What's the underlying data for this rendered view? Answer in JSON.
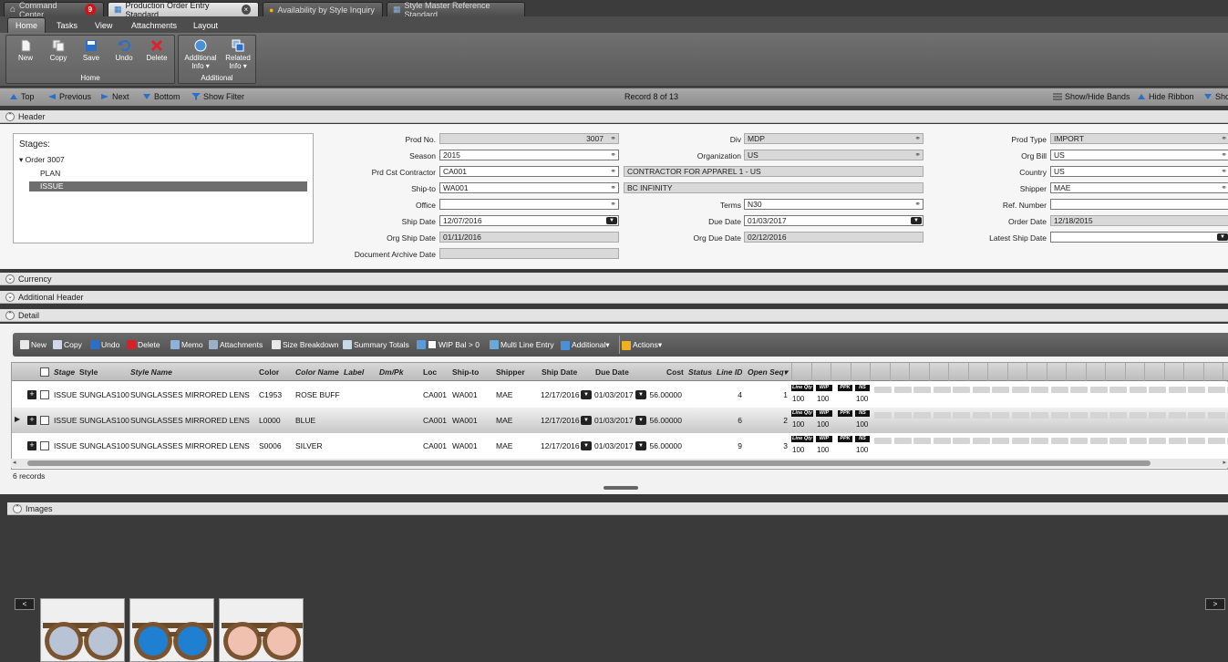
{
  "doc_tabs": [
    {
      "label": "Command Center",
      "badge": "9",
      "icon": "home-icon"
    },
    {
      "label": "Production Order Entry Standard",
      "close": "×",
      "icon": "form-icon",
      "active": true
    },
    {
      "label": "Availability by Style Inquiry",
      "icon": "info-icon"
    },
    {
      "label": "Style Master Reference Standard",
      "icon": "form-icon"
    }
  ],
  "menu": [
    "Home",
    "Tasks",
    "View",
    "Attachments",
    "Layout"
  ],
  "ribbon": {
    "group_home": {
      "label": "Home",
      "buttons": [
        "New",
        "Copy",
        "Save",
        "Undo",
        "Delete"
      ]
    },
    "group_additional": {
      "label": "Additional",
      "buttons": [
        {
          "line1": "Additional",
          "line2": "Info ▾"
        },
        {
          "line1": "Related",
          "line2": "Info ▾"
        }
      ]
    }
  },
  "navbar": {
    "top": "Top",
    "previous": "Previous",
    "next": "Next",
    "bottom": "Bottom",
    "show_filter": "Show Filter",
    "record": "Record 8 of 13",
    "show_hide_bands": "Show/Hide Bands",
    "hide_ribbon": "Hide Ribbon",
    "show": "Sho"
  },
  "sections": {
    "header": "Header",
    "currency": "Currency",
    "additional_header": "Additional Header",
    "detail": "Detail",
    "images": "Images"
  },
  "stages": {
    "title": "Stages:",
    "root": "Order 3007",
    "items": [
      "PLAN",
      "ISSUE"
    ]
  },
  "header_fields": {
    "col1": [
      {
        "label": "Prod No.",
        "value": "3007",
        "ro": true,
        "align": "right",
        "lookup": true
      },
      {
        "label": "Season",
        "value": "2015",
        "lookup": true
      },
      {
        "label": "Prd Cst Contractor",
        "value": "CA001",
        "lookup": true,
        "desc": "CONTRACTOR FOR APPAREL 1 - US"
      },
      {
        "label": "Ship-to",
        "value": "WA001",
        "lookup": true,
        "desc": "BC INFINITY"
      },
      {
        "label": "Office",
        "value": "",
        "lookup": true
      },
      {
        "label": "Ship Date",
        "value": "12/07/2016",
        "dropdown": true
      },
      {
        "label": "Org Ship Date",
        "value": "01/11/2016",
        "ro": true
      },
      {
        "label": "Document Archive Date",
        "value": "",
        "ro": true
      }
    ],
    "col2": [
      {
        "label": "Div",
        "value": "MDP",
        "ro": true,
        "lookup": true
      },
      {
        "label": "Organization",
        "value": "US",
        "ro": true,
        "lookup": true
      },
      {
        "label": "",
        "value": ""
      },
      {
        "label": "",
        "value": ""
      },
      {
        "label": "Terms",
        "value": "N30",
        "lookup": true
      },
      {
        "label": "Due Date",
        "value": "01/03/2017",
        "dropdown": true
      },
      {
        "label": "Org Due Date",
        "value": "02/12/2016",
        "ro": true
      }
    ],
    "col3": [
      {
        "label": "Prod Type",
        "value": "IMPORT",
        "ro": true,
        "lookup": true
      },
      {
        "label": "Org Bill",
        "value": "US",
        "lookup": true
      },
      {
        "label": "Country",
        "value": "US",
        "lookup": true
      },
      {
        "label": "Shipper",
        "value": "MAE",
        "lookup": true
      },
      {
        "label": "Ref. Number",
        "value": ""
      },
      {
        "label": "Order Date",
        "value": "12/18/2015",
        "ro": true
      },
      {
        "label": "Latest Ship Date",
        "value": "",
        "dropdown": true
      }
    ]
  },
  "detail_toolbar": [
    {
      "label": "New",
      "color": "#e8e8e8"
    },
    {
      "label": "Copy",
      "color": "#cfd8e8"
    },
    {
      "label": "Undo",
      "color": "#2a6fc9"
    },
    {
      "label": "Delete",
      "color": "#d8202a"
    },
    {
      "label": "Memo",
      "color": "#8fb0d8"
    },
    {
      "label": "Attachments",
      "color": "#9ab0c8"
    },
    {
      "label": "Size Breakdown",
      "color": "#e8e8e8"
    },
    {
      "label": "Summary Totals",
      "color": "#c8d8e8"
    },
    {
      "label": "WIP Bal > 0",
      "color": "#5a9ad8"
    },
    {
      "label": "Multi Line Entry",
      "color": "#6aa8d8"
    },
    {
      "label": "Additional▾",
      "color": "#4a90d8"
    },
    {
      "label": "Actions▾",
      "color": "#f0b020"
    }
  ],
  "grid": {
    "columns": [
      "Stage",
      "Style",
      "Style Name",
      "Color",
      "Color Name",
      "Label",
      "Dm/Pk",
      "Loc",
      "Ship-to",
      "Shipper",
      "Ship Date",
      "Due Date",
      "Cost",
      "Status",
      "Line ID",
      "Open Seq"
    ],
    "size_tags": [
      "Line Qty",
      "WIP",
      "PPK",
      "NS"
    ],
    "rows": [
      {
        "stage": "ISSUE",
        "style": "SUNGLAS100",
        "style_name": "SUNGLASSES MIRRORED LENS",
        "color": "C1953",
        "color_name": "ROSE BUFF",
        "loc": "CA001",
        "ship_to": "WA001",
        "shipper": "MAE",
        "ship_date": "12/17/2016",
        "due_date": "01/03/2017",
        "cost": "56.00000",
        "line_id": "4",
        "open_seq": "1",
        "qty": [
          "100",
          "100",
          "",
          "100"
        ]
      },
      {
        "stage": "ISSUE",
        "style": "SUNGLAS100",
        "style_name": "SUNGLASSES MIRRORED LENS",
        "color": "L0000",
        "color_name": "BLUE",
        "loc": "CA001",
        "ship_to": "WA001",
        "shipper": "MAE",
        "ship_date": "12/17/2016",
        "due_date": "01/03/2017",
        "cost": "56.00000",
        "line_id": "6",
        "open_seq": "2",
        "qty": [
          "100",
          "100",
          "",
          "100"
        ]
      },
      {
        "stage": "ISSUE",
        "style": "SUNGLAS100",
        "style_name": "SUNGLASSES MIRRORED LENS",
        "color": "S0006",
        "color_name": "SILVER",
        "loc": "CA001",
        "ship_to": "WA001",
        "shipper": "MAE",
        "ship_date": "12/17/2016",
        "due_date": "01/03/2017",
        "cost": "56.00000",
        "line_id": "9",
        "open_seq": "3",
        "qty": [
          "100",
          "100",
          "",
          "100"
        ]
      }
    ],
    "record_count": "6 records"
  },
  "images": {
    "prev": "<",
    "next": ">",
    "lens_colors": [
      "#b9c3d6",
      "#1f7fd0",
      "#f0c0b0"
    ]
  },
  "colors": {
    "accent": "#2a6fc9",
    "selection": "#6e6e6e"
  }
}
